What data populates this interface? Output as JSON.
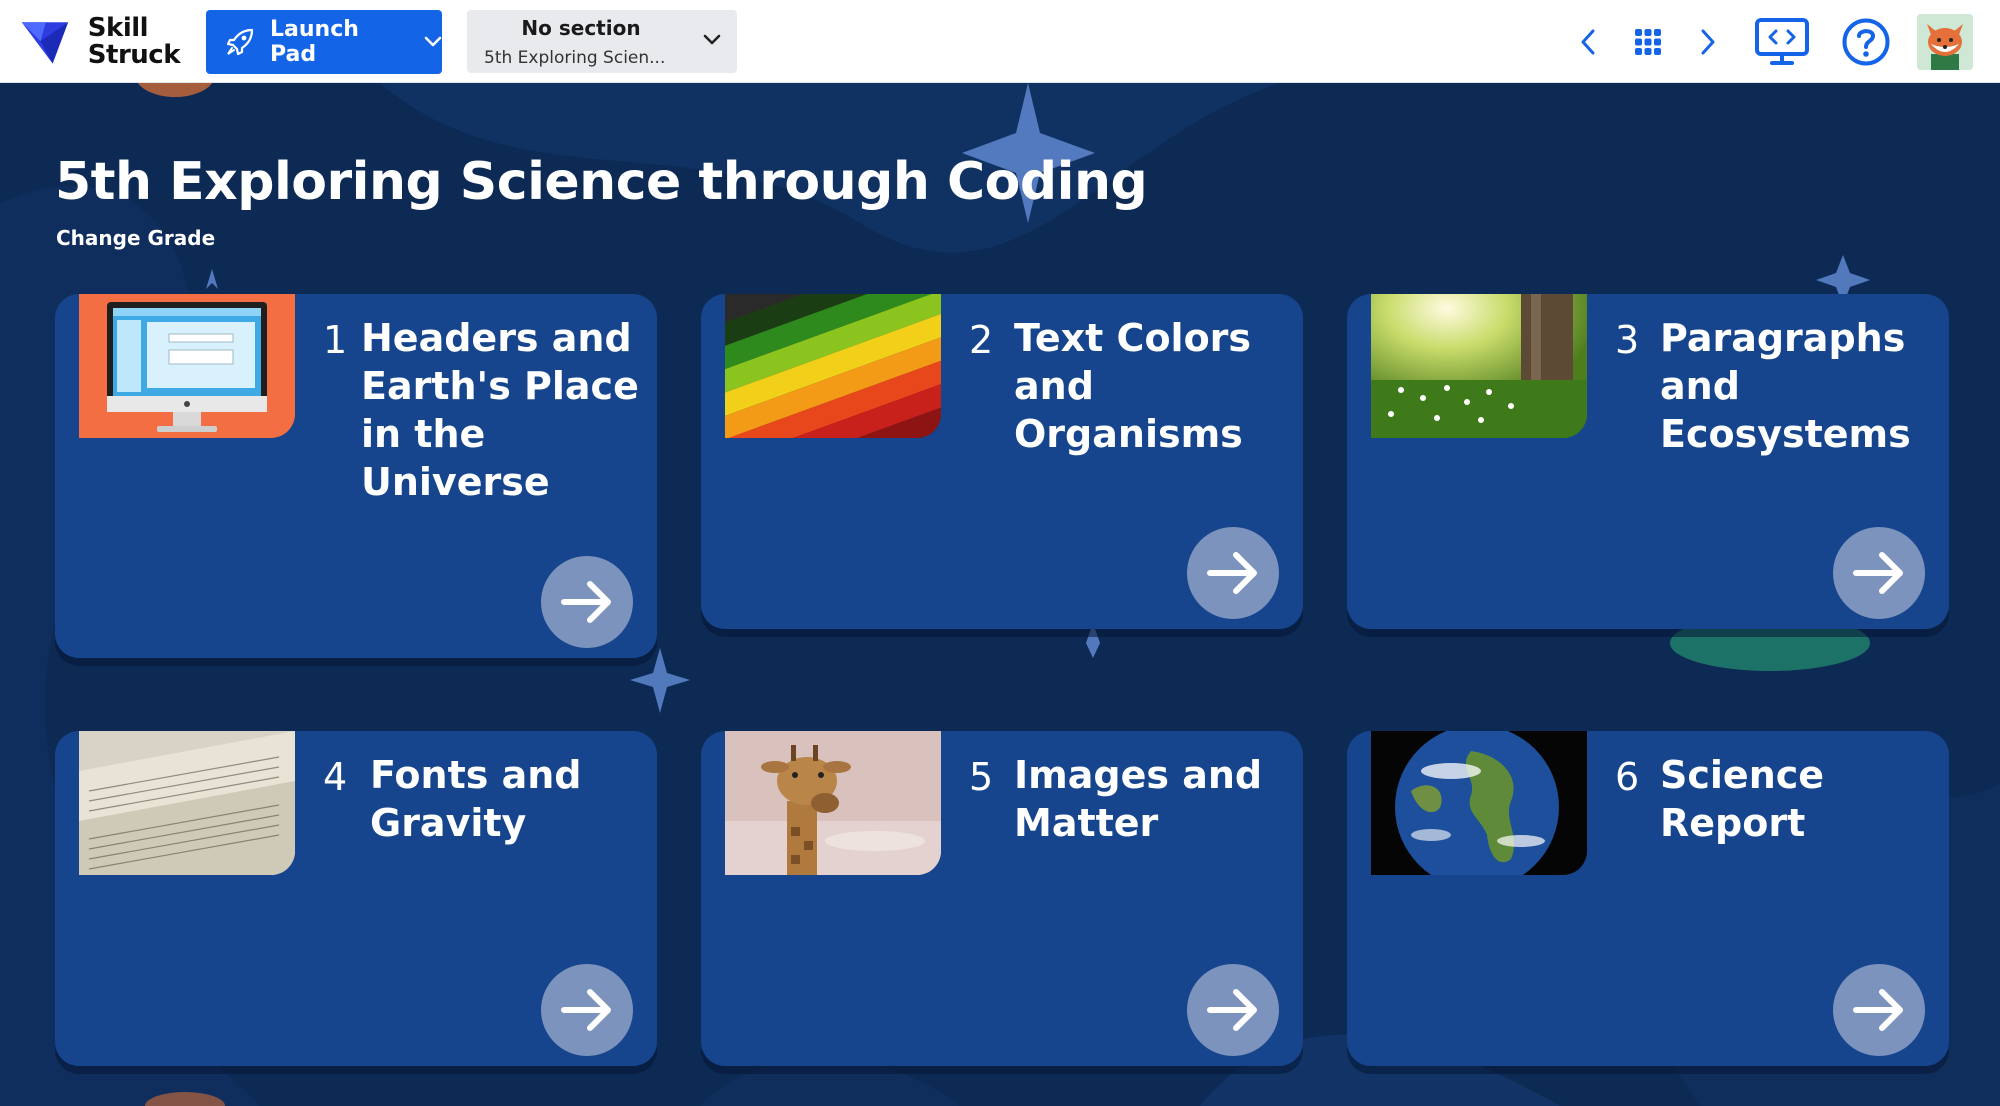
{
  "brand": {
    "line1": "Skill",
    "line2": "Struck"
  },
  "header": {
    "launch_pad_label": "Launch Pad",
    "section_title": "No section",
    "section_subtitle": "5th Exploring Scien..."
  },
  "page": {
    "title": "5th Exploring Science through Coding",
    "change_grade": "Change Grade"
  },
  "lessons": [
    {
      "number": "1",
      "title": "Headers and Earth's Place in the Universe",
      "thumbnail": "computer-monitor-image"
    },
    {
      "number": "2",
      "title": "Text Colors and Organisms",
      "thumbnail": "colored-pencils-image"
    },
    {
      "number": "3",
      "title": "Paragraphs and Ecosystems",
      "thumbnail": "forest-meadow-image"
    },
    {
      "number": "4",
      "title": "Fonts and Gravity",
      "thumbnail": "handwritten-pages-image"
    },
    {
      "number": "5",
      "title": "Images and Matter",
      "thumbnail": "giraffe-image"
    },
    {
      "number": "6",
      "title": "Science Report",
      "thumbnail": "earth-globe-image"
    }
  ],
  "icons": {
    "logo": "skillstruck-logo-icon",
    "launch": "rocket-icon",
    "prev": "chevron-left-icon",
    "grid": "grid-menu-icon",
    "next": "chevron-right-icon",
    "present": "code-monitor-icon",
    "help": "help-question-icon",
    "avatar": "fox-avatar"
  },
  "colors": {
    "accent": "#1464e8",
    "background": "#0d2a55",
    "card": "#16458d",
    "arrow_button": "#7c93bd"
  }
}
